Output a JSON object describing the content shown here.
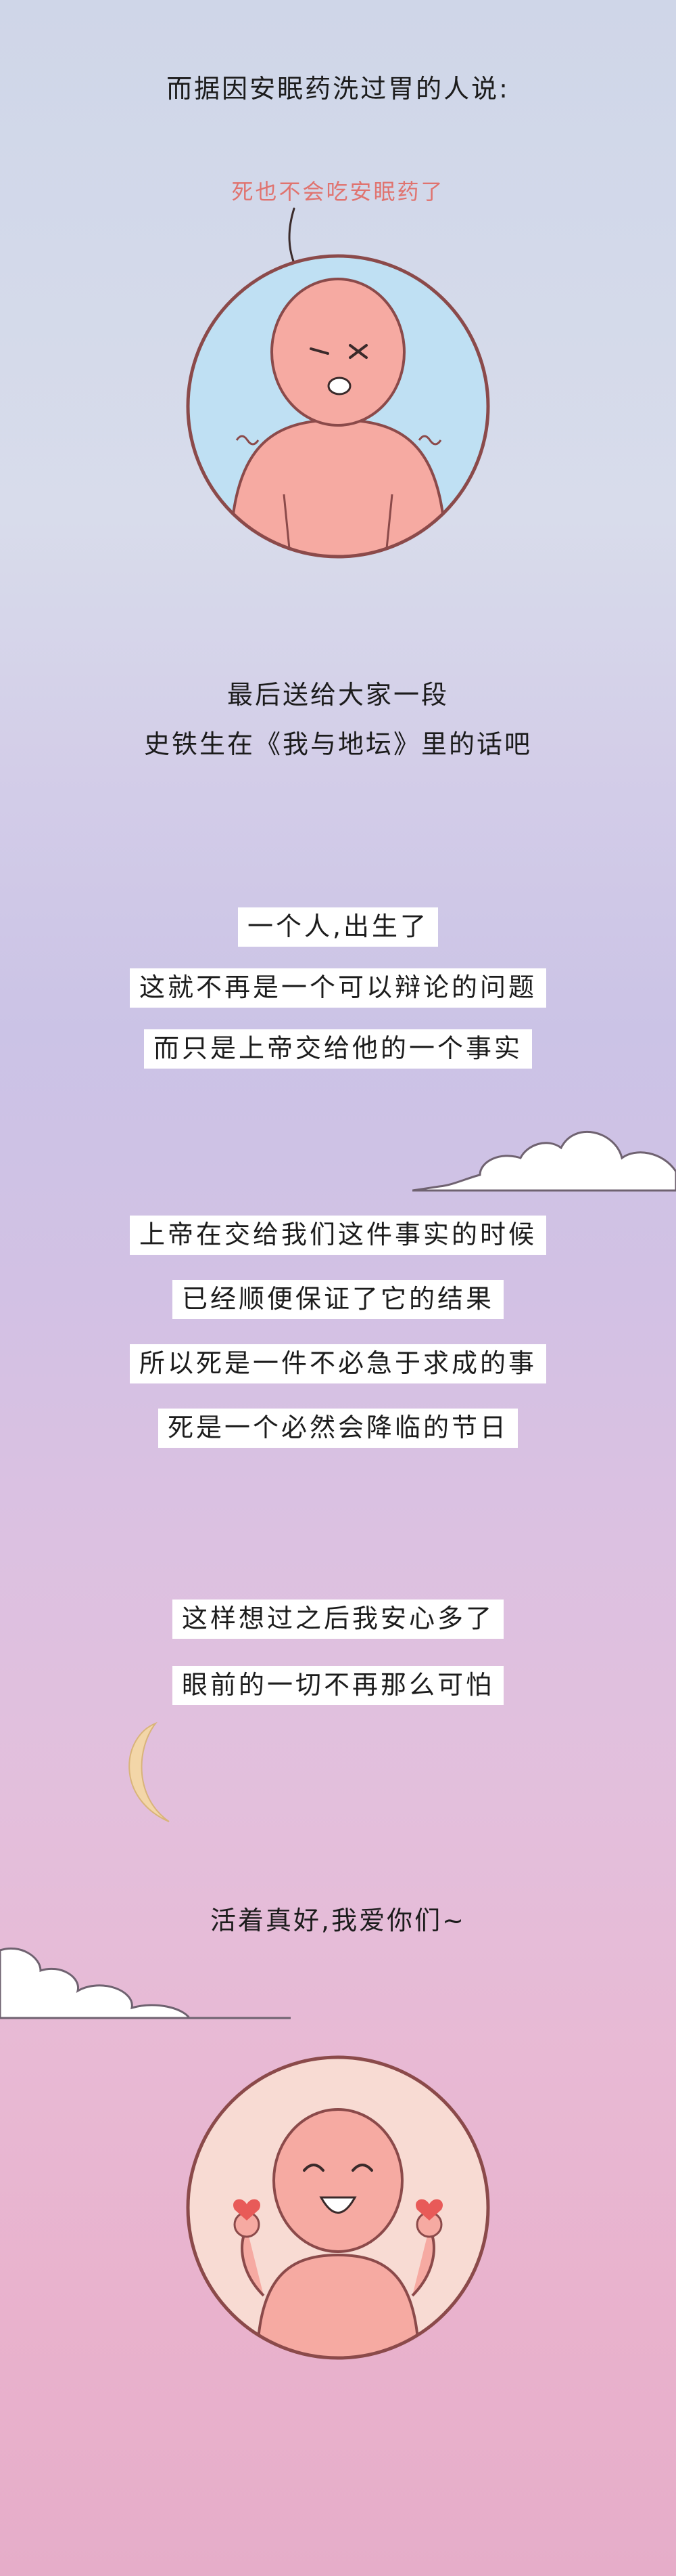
{
  "intro_text": "而据因安眠药洗过胃的人说:",
  "speech_text": "死也不会吃安眠药了",
  "section1": [
    "最后送给大家一段",
    "史铁生在《我与地坛》里的话吧"
  ],
  "quote_block_1": [
    "一个人,出生了",
    "这就不再是一个可以辩论的问题",
    "而只是上帝交给他的一个事实"
  ],
  "quote_block_2": [
    "上帝在交给我们这件事实的时候",
    "已经顺便保证了它的结果",
    "所以死是一件不必急于求成的事",
    "死是一个必然会降临的节日"
  ],
  "quote_block_3": [
    "这样想过之后我安心多了",
    "眼前的一切不再那么可怕"
  ],
  "closing_text": "活着真好,我爱你们~",
  "colors": {
    "speech": "#e0736f",
    "circle_top_bg": "#bfe0f3",
    "circle_bottom_bg": "#f8dbd3",
    "skin": "#f6aaa2",
    "outline": "#8b4a4a",
    "heart": "#e85a58"
  }
}
